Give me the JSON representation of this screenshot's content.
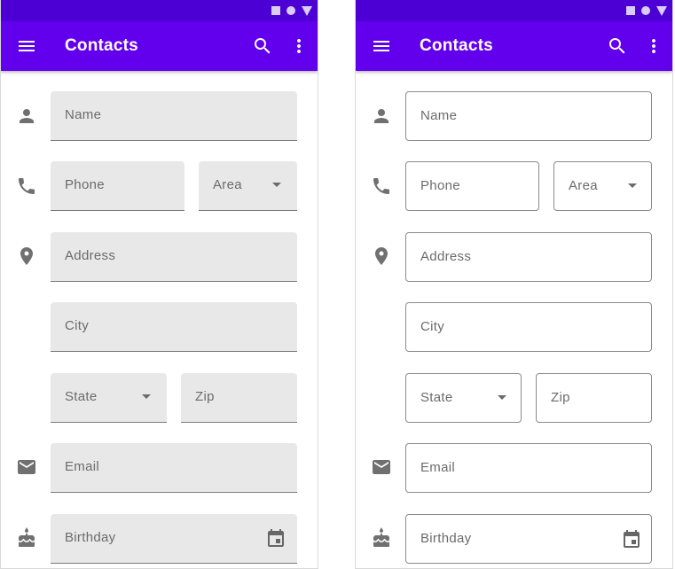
{
  "screens": [
    {
      "variant": "filled",
      "app_bar": {
        "title": "Contacts",
        "menu_icon": "menu-icon",
        "search_icon": "search-icon",
        "more_icon": "more-vert-icon"
      },
      "fields": {
        "name": "Name",
        "phone": "Phone",
        "area": "Area",
        "address": "Address",
        "city": "City",
        "state": "State",
        "zip": "Zip",
        "email": "Email",
        "birthday": "Birthday"
      }
    },
    {
      "variant": "outlined",
      "app_bar": {
        "title": "Contacts",
        "menu_icon": "menu-icon",
        "search_icon": "search-icon",
        "more_icon": "more-vert-icon"
      },
      "fields": {
        "name": "Name",
        "phone": "Phone",
        "area": "Area",
        "address": "Address",
        "city": "City",
        "state": "State",
        "zip": "Zip",
        "email": "Email",
        "birthday": "Birthday"
      }
    }
  ],
  "colors": {
    "status_bar": "#4d00d4",
    "app_bar": "#6200ee",
    "filled_field": "#e8e8e8",
    "icon": "#707070"
  }
}
